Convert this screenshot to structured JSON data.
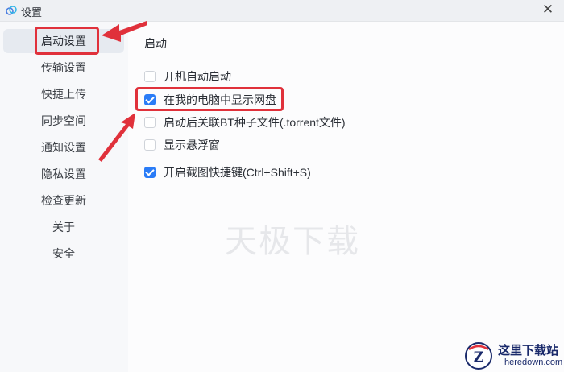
{
  "window": {
    "title": "设置",
    "close_icon": "close-icon",
    "app_icon": "cloud-drive-icon"
  },
  "sidebar": {
    "items": [
      {
        "label": "启动设置",
        "active": true
      },
      {
        "label": "传输设置"
      },
      {
        "label": "快捷上传"
      },
      {
        "label": "同步空间"
      },
      {
        "label": "通知设置"
      },
      {
        "label": "隐私设置"
      },
      {
        "label": "检查更新"
      },
      {
        "label": "关于"
      },
      {
        "label": "安全"
      }
    ]
  },
  "content": {
    "section_title": "启动",
    "options": [
      {
        "label": "开机自动启动",
        "checked": false
      },
      {
        "label": "在我的电脑中显示网盘",
        "checked": true
      },
      {
        "label": "启动后关联BT种子文件(.torrent文件)",
        "checked": false
      },
      {
        "label": "显示悬浮窗",
        "checked": false
      },
      {
        "label": "开启截图快捷键(Ctrl+Shift+S)",
        "checked": true
      }
    ]
  },
  "watermark": "天极下载",
  "logo": {
    "main": "这里下载站",
    "sub": "heredown.com",
    "letter": "Z"
  },
  "colors": {
    "accent": "#2a7cf7",
    "highlight": "#e0313b",
    "logo": "#1a2a6b"
  }
}
